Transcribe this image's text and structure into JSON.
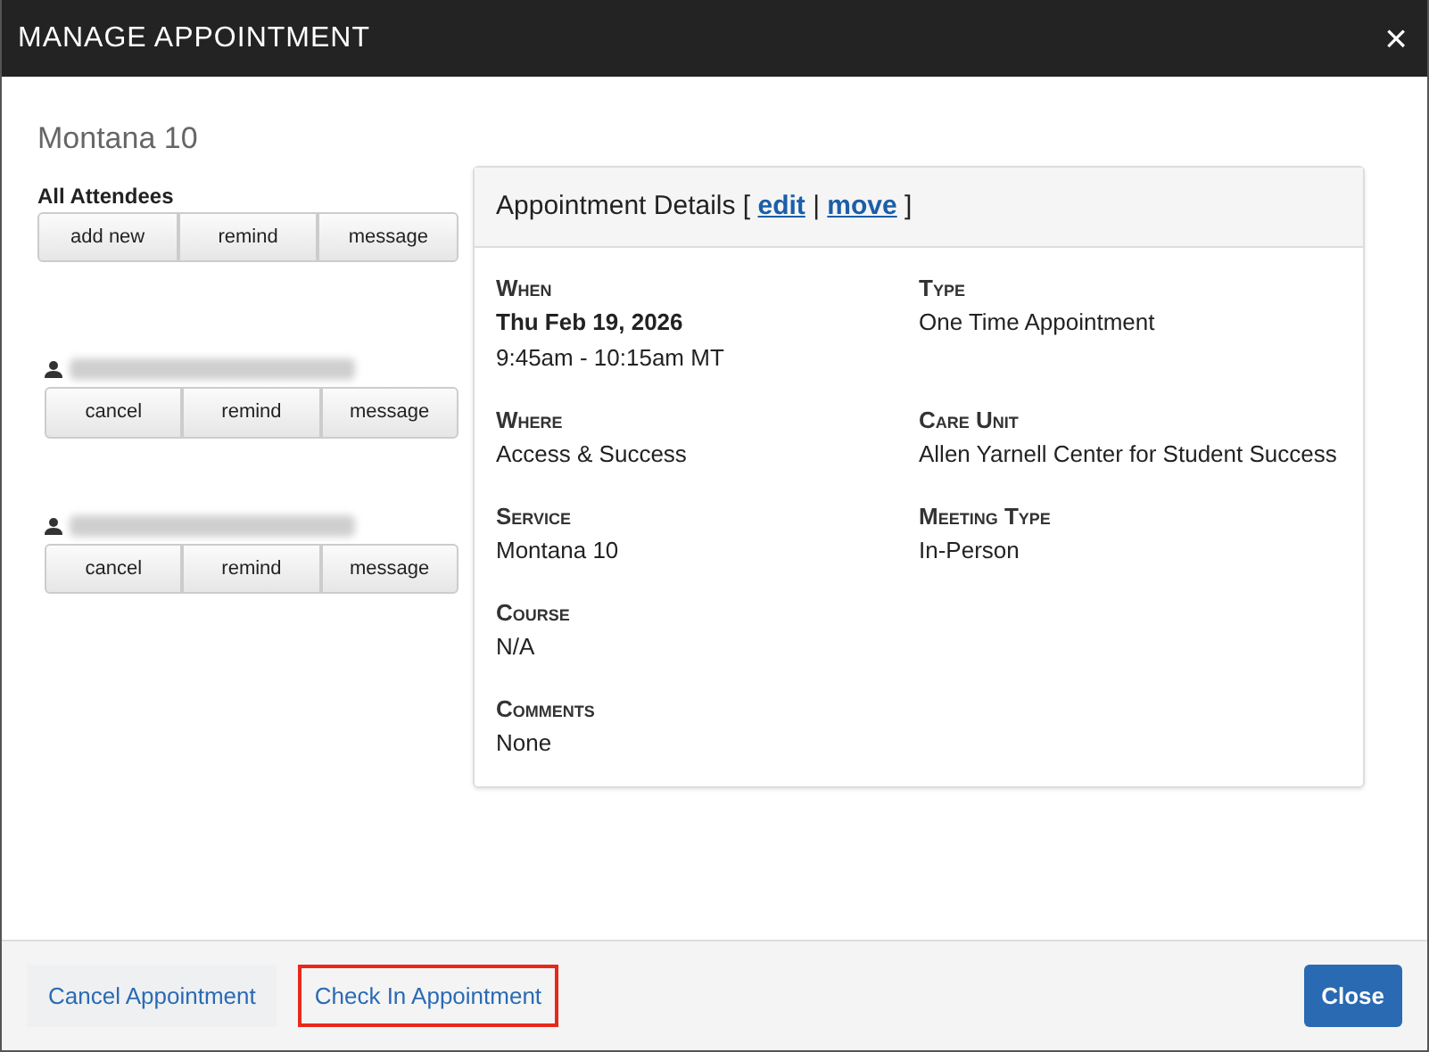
{
  "window": {
    "title": "MANAGE APPOINTMENT",
    "close": "×"
  },
  "heading": "Montana 10",
  "attendees": {
    "label": "All Attendees",
    "buttons": [
      "add new",
      "remind",
      "message"
    ],
    "people": [
      {
        "buttons": [
          "cancel",
          "remind",
          "message"
        ]
      },
      {
        "buttons": [
          "cancel",
          "remind",
          "message"
        ]
      }
    ]
  },
  "details": {
    "title": "Appointment Details",
    "open": "[",
    "links": [
      "edit",
      "move"
    ],
    "separator": "|",
    "close": "]",
    "rows": [
      [
        {
          "label": "When",
          "values": [
            "Thu Feb 19, 2026",
            "9:45am - 10:15am MT"
          ],
          "bold_first": true
        },
        {
          "label": "Type",
          "values": [
            "One Time Appointment"
          ]
        }
      ],
      [
        {
          "label": "Where",
          "values": [
            "Access & Success"
          ]
        },
        {
          "label": "Care Unit",
          "values": [
            "Allen Yarnell Center for Student Success"
          ]
        }
      ],
      [
        {
          "label": "Service",
          "values": [
            "Montana 10"
          ]
        },
        {
          "label": "Meeting Type",
          "values": [
            "In-Person"
          ]
        }
      ],
      [
        {
          "label": "Course",
          "values": [
            "N/A"
          ]
        }
      ],
      [
        {
          "label": "Comments",
          "values": [
            "None"
          ]
        }
      ]
    ]
  },
  "footer": {
    "buttons": [
      {
        "label": "Cancel Appointment",
        "kind": "link",
        "highlighted": false
      },
      {
        "label": "Check In Appointment",
        "kind": "link",
        "highlighted": true
      },
      {
        "label": "Close",
        "kind": "primary",
        "highlighted": false
      }
    ]
  }
}
